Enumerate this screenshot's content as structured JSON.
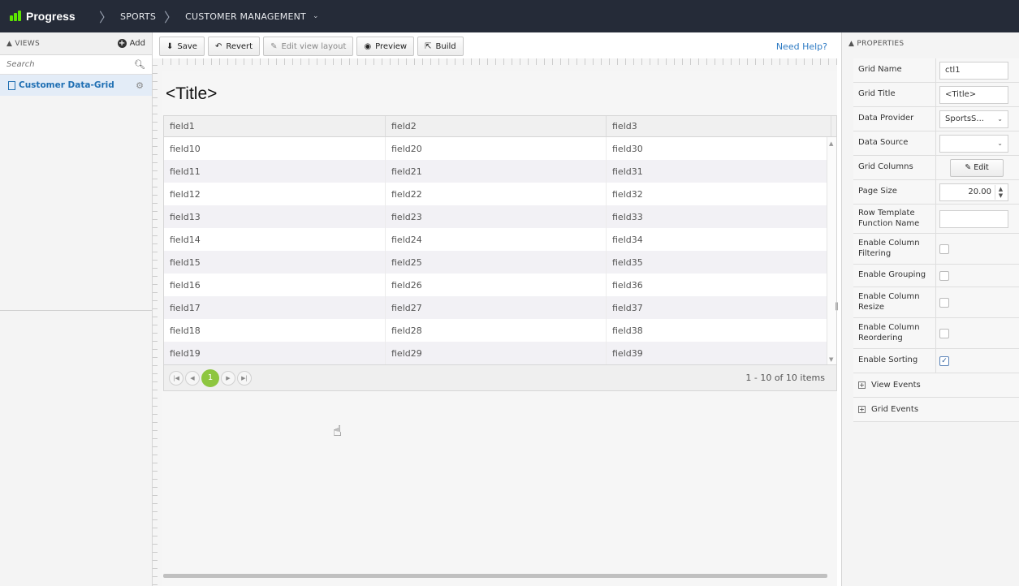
{
  "topbar": {
    "logo": "Progress",
    "breadcrumbs": [
      "SPORTS",
      "CUSTOMER MANAGEMENT"
    ]
  },
  "views_panel": {
    "header": "VIEWS",
    "add_label": "Add",
    "search_placeholder": "Search",
    "items": [
      {
        "label": "Customer Data-Grid"
      }
    ]
  },
  "toolbar": {
    "save": "Save",
    "revert": "Revert",
    "edit_layout": "Edit view layout",
    "preview": "Preview",
    "build": "Build",
    "help": "Need Help?"
  },
  "grid": {
    "title": "<Title>",
    "columns": [
      "field1",
      "field2",
      "field3"
    ],
    "rows": [
      [
        "field10",
        "field20",
        "field30"
      ],
      [
        "field11",
        "field21",
        "field31"
      ],
      [
        "field12",
        "field22",
        "field32"
      ],
      [
        "field13",
        "field23",
        "field33"
      ],
      [
        "field14",
        "field24",
        "field34"
      ],
      [
        "field15",
        "field25",
        "field35"
      ],
      [
        "field16",
        "field26",
        "field36"
      ],
      [
        "field17",
        "field27",
        "field37"
      ],
      [
        "field18",
        "field28",
        "field38"
      ],
      [
        "field19",
        "field29",
        "field39"
      ]
    ],
    "current_page": "1",
    "pager_info": "1 - 10 of 10 items"
  },
  "properties": {
    "header": "PROPERTIES",
    "grid_name_label": "Grid Name",
    "grid_name_value": "ctl1",
    "grid_title_label": "Grid Title",
    "grid_title_value": "<Title>",
    "data_provider_label": "Data Provider",
    "data_provider_value": "SportsS...",
    "data_source_label": "Data Source",
    "data_source_value": "",
    "grid_columns_label": "Grid Columns",
    "edit_button": "Edit",
    "page_size_label": "Page Size",
    "page_size_value": "20.00",
    "row_template_label": "Row Template Function Name",
    "row_template_value": "",
    "filtering_label": "Enable Column Filtering",
    "filtering_checked": false,
    "grouping_label": "Enable Grouping",
    "grouping_checked": false,
    "resize_label": "Enable Column Resize",
    "resize_checked": false,
    "reorder_label": "Enable Column Reordering",
    "reorder_checked": false,
    "sorting_label": "Enable Sorting",
    "sorting_checked": true,
    "view_events": "View Events",
    "grid_events": "Grid Events"
  }
}
